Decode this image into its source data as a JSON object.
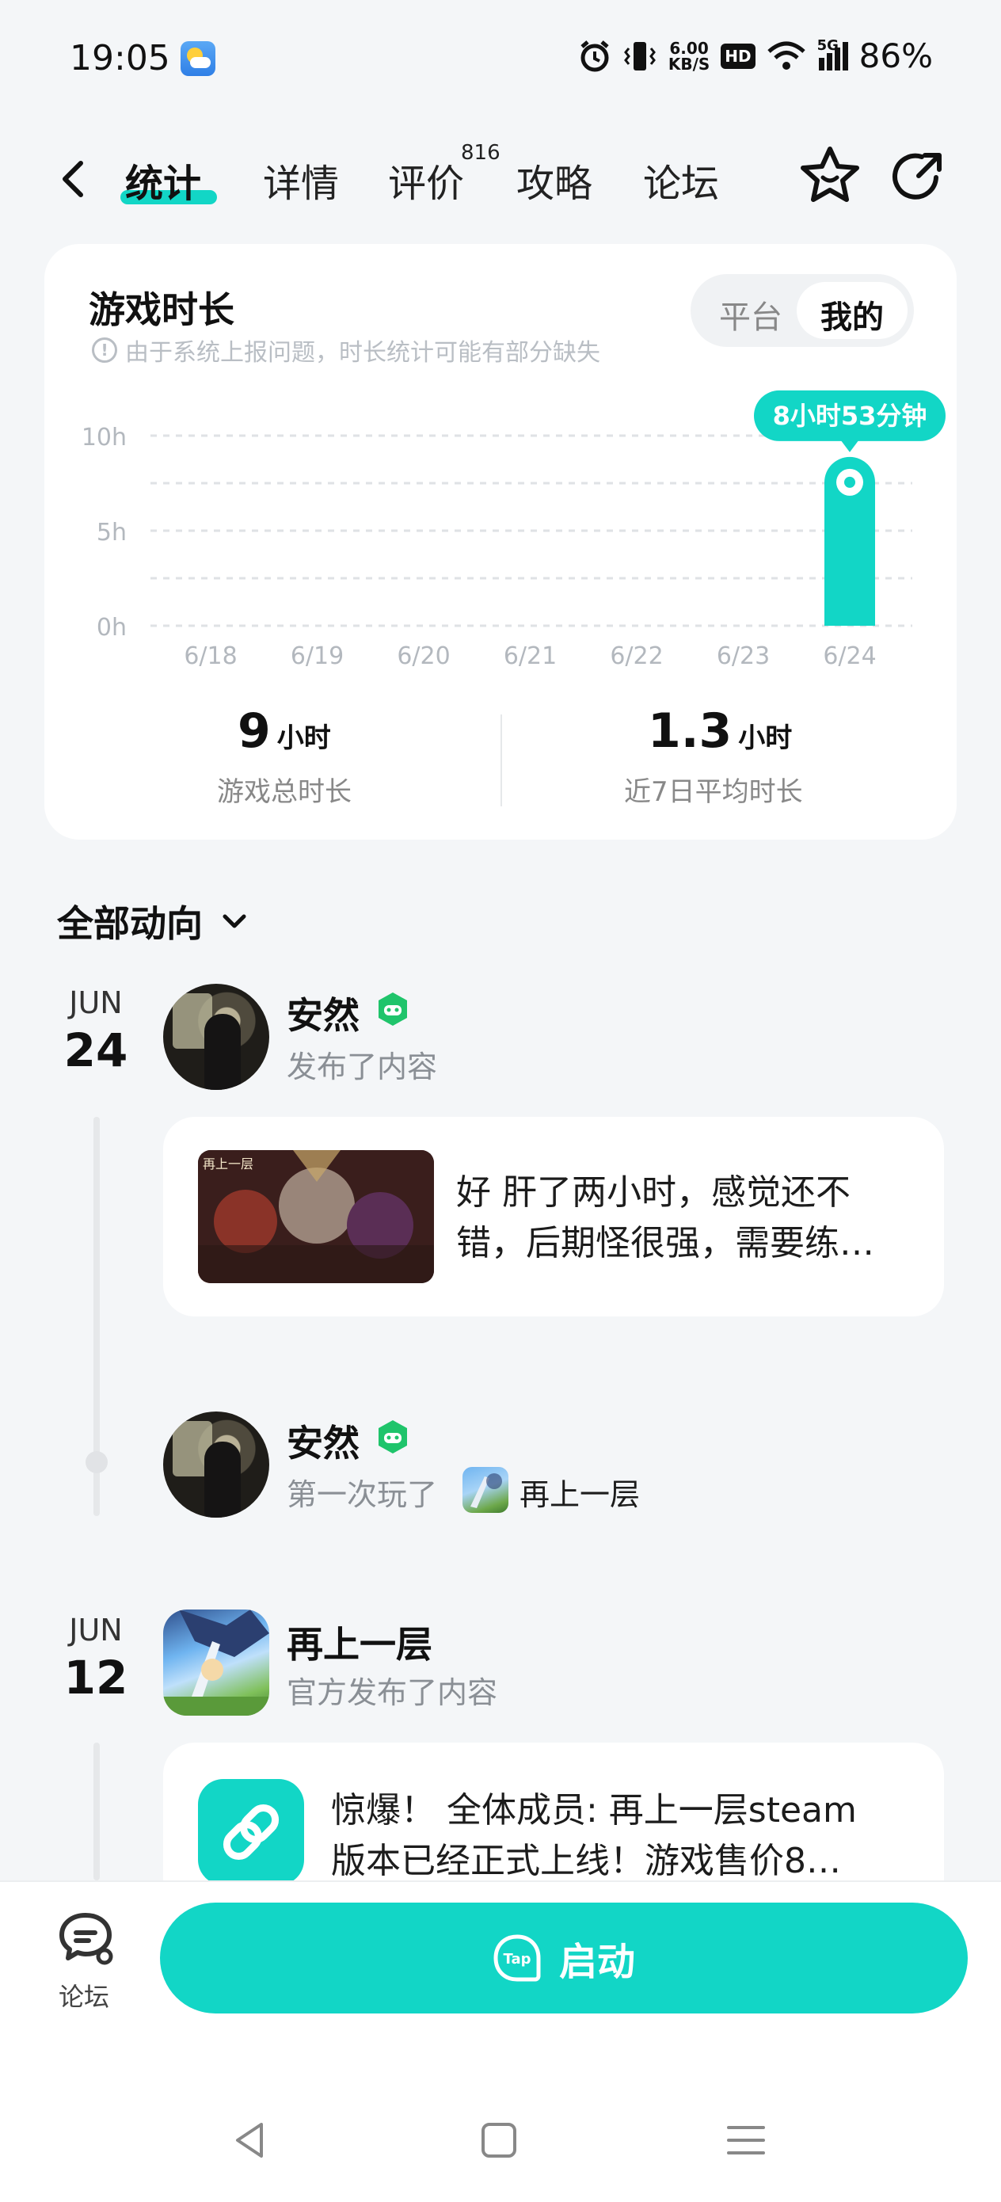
{
  "status_bar": {
    "time": "19:05",
    "net_speed_value": "6.00",
    "net_speed_unit": "KB/S",
    "hd": "HD",
    "signal": "5G",
    "battery": "86%",
    "icons": [
      "weather-icon",
      "alarm-icon",
      "vibrate-icon",
      "wifi-icon",
      "signal-icon"
    ]
  },
  "nav": {
    "tabs": [
      {
        "label": "统计",
        "active": true
      },
      {
        "label": "详情",
        "active": false
      },
      {
        "label": "评价",
        "active": false
      },
      {
        "label": "攻略",
        "active": false
      },
      {
        "label": "论坛",
        "active": false
      }
    ],
    "review_count": "816",
    "icons": [
      "back-icon",
      "star-icon",
      "share-icon"
    ]
  },
  "playtime_card": {
    "title": "游戏时长",
    "note": "由于系统上报问题，时长统计可能有部分缺失",
    "toggle": {
      "options": [
        "平台",
        "我的"
      ],
      "selected": "我的"
    },
    "tooltip": "8小时53分钟",
    "total_value": "9",
    "total_unit": "小时",
    "total_label": "游戏总时长",
    "avg_value": "1.3",
    "avg_unit": "小时",
    "avg_label": "近7日平均时长"
  },
  "chart_data": {
    "type": "bar",
    "categories": [
      "6/18",
      "6/19",
      "6/20",
      "6/21",
      "6/22",
      "6/23",
      "6/24"
    ],
    "values": [
      0,
      0,
      0,
      0,
      0,
      0,
      8.88
    ],
    "y_ticks": [
      "0h",
      "5h",
      "10h"
    ],
    "ylim": [
      0,
      10
    ],
    "grid": true,
    "bar_color": "#12d6c6"
  },
  "feed": {
    "title": "全部动向",
    "groups": [
      {
        "month": "JUN",
        "day": "24",
        "items": [
          {
            "user": "安然",
            "action": "发布了内容",
            "post_text_line1": "好 肝了两小时，感觉还不",
            "post_text_line2": "错，后期怪很强，需要练…",
            "image_caption": "再上一层"
          },
          {
            "user": "安然",
            "action": "第一次玩了",
            "game": "再上一层"
          }
        ]
      },
      {
        "month": "JUN",
        "day": "12",
        "items": [
          {
            "user": "再上一层",
            "action": "官方发布了内容",
            "post_text_line1": "惊爆！ 全体成员: 再上一层steam",
            "post_text_line2": "版本已经正式上线！游戏售价8…"
          }
        ]
      }
    ]
  },
  "bottom": {
    "forum_label": "论坛",
    "launch_label": "启动",
    "tap_text": "Tap"
  },
  "colors": {
    "accent": "#12d6c6",
    "bg": "#f4f6f8"
  }
}
